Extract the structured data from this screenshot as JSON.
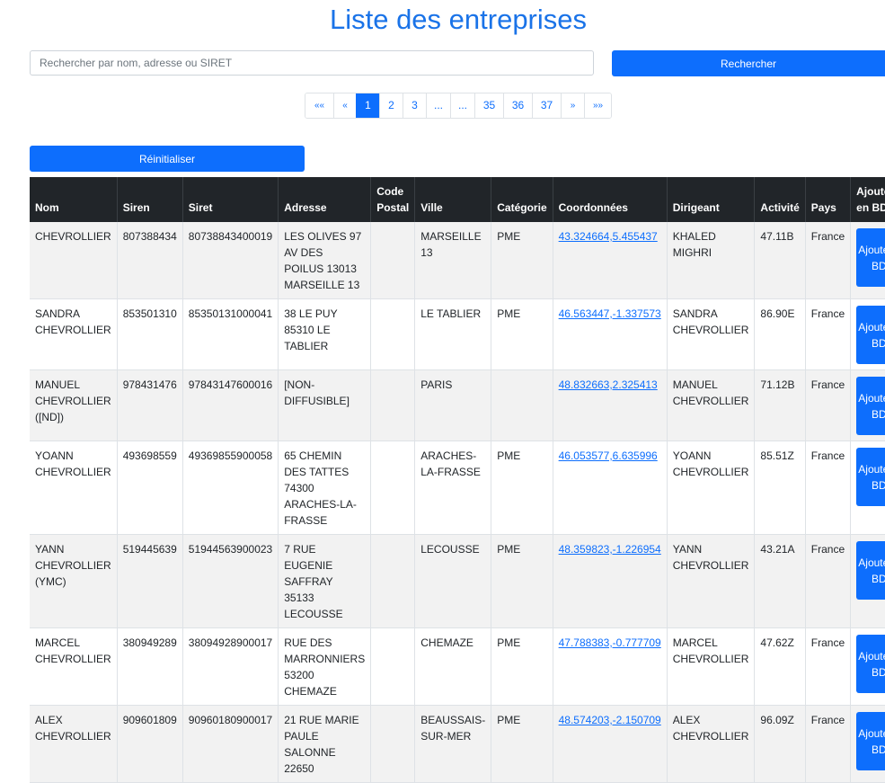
{
  "page": {
    "title": "Liste des entreprises"
  },
  "search": {
    "placeholder": "Rechercher par nom, adresse ou SIRET",
    "button_label": "Rechercher"
  },
  "pagination": [
    {
      "label": "««",
      "active": false,
      "small": true
    },
    {
      "label": "«",
      "active": false,
      "small": true
    },
    {
      "label": "1",
      "active": true,
      "small": false
    },
    {
      "label": "2",
      "active": false,
      "small": false
    },
    {
      "label": "3",
      "active": false,
      "small": false
    },
    {
      "label": "...",
      "active": false,
      "small": false
    },
    {
      "label": "...",
      "active": false,
      "small": false
    },
    {
      "label": "35",
      "active": false,
      "small": false
    },
    {
      "label": "36",
      "active": false,
      "small": false
    },
    {
      "label": "37",
      "active": false,
      "small": false
    },
    {
      "label": "»",
      "active": false,
      "small": true
    },
    {
      "label": "»»",
      "active": false,
      "small": true
    }
  ],
  "reset_button_label": "Réinitialiser",
  "table": {
    "headers": [
      "Nom",
      "Siren",
      "Siret",
      "Adresse",
      "Code Postal",
      "Ville",
      "Catégorie",
      "Coordonnées",
      "Dirigeant",
      "Activité",
      "Pays",
      "Ajouter en BDD"
    ],
    "add_button_label": "Ajouter en BDD",
    "rows": [
      {
        "nom": "CHEVROLLIER",
        "siren": "807388434",
        "siret": "80738843400019",
        "adresse": "LES OLIVES 97 AV DES POILUS 13013 MARSEILLE 13",
        "code_postal": "",
        "ville": "MARSEILLE 13",
        "categorie": "PME",
        "coordonnees": "43.324664,5.455437",
        "dirigeant": "KHALED MIGHRI",
        "activite": "47.11B",
        "pays": "France"
      },
      {
        "nom": "SANDRA CHEVROLLIER",
        "siren": "853501310",
        "siret": "85350131000041",
        "adresse": "38 LE PUY 85310 LE TABLIER",
        "code_postal": "",
        "ville": "LE TABLIER",
        "categorie": "PME",
        "coordonnees": "46.563447,-1.337573",
        "dirigeant": "SANDRA CHEVROLLIER",
        "activite": "86.90E",
        "pays": "France"
      },
      {
        "nom": "MANUEL CHEVROLLIER ([ND])",
        "siren": "978431476",
        "siret": "97843147600016",
        "adresse": "[NON-DIFFUSIBLE]",
        "code_postal": "",
        "ville": "PARIS",
        "categorie": "",
        "coordonnees": "48.832663,2.325413",
        "dirigeant": "MANUEL CHEVROLLIER",
        "activite": "71.12B",
        "pays": "France"
      },
      {
        "nom": "YOANN CHEVROLLIER",
        "siren": "493698559",
        "siret": "49369855900058",
        "adresse": "65 CHEMIN DES TATTES 74300 ARACHES-LA-FRASSE",
        "code_postal": "",
        "ville": "ARACHES-LA-FRASSE",
        "categorie": "PME",
        "coordonnees": "46.053577,6.635996",
        "dirigeant": "YOANN CHEVROLLIER",
        "activite": "85.51Z",
        "pays": "France"
      },
      {
        "nom": "YANN CHEVROLLIER (YMC)",
        "siren": "519445639",
        "siret": "51944563900023",
        "adresse": "7 RUE EUGENIE SAFFRAY 35133 LECOUSSE",
        "code_postal": "",
        "ville": "LECOUSSE",
        "categorie": "PME",
        "coordonnees": "48.359823,-1.226954",
        "dirigeant": "YANN CHEVROLLIER",
        "activite": "43.21A",
        "pays": "France"
      },
      {
        "nom": "MARCEL CHEVROLLIER",
        "siren": "380949289",
        "siret": "38094928900017",
        "adresse": "RUE DES MARRONNIERS 53200 CHEMAZE",
        "code_postal": "",
        "ville": "CHEMAZE",
        "categorie": "PME",
        "coordonnees": "47.788383,-0.777709",
        "dirigeant": "MARCEL CHEVROLLIER",
        "activite": "47.62Z",
        "pays": "France"
      },
      {
        "nom": "ALEX CHEVROLLIER",
        "siren": "909601809",
        "siret": "90960180900017",
        "adresse": "21 RUE MARIE PAULE SALONNE 22650",
        "code_postal": "",
        "ville": "BEAUSSAIS-SUR-MER",
        "categorie": "PME",
        "coordonnees": "48.574203,-2.150709",
        "dirigeant": "ALEX CHEVROLLIER",
        "activite": "96.09Z",
        "pays": "France"
      }
    ]
  }
}
